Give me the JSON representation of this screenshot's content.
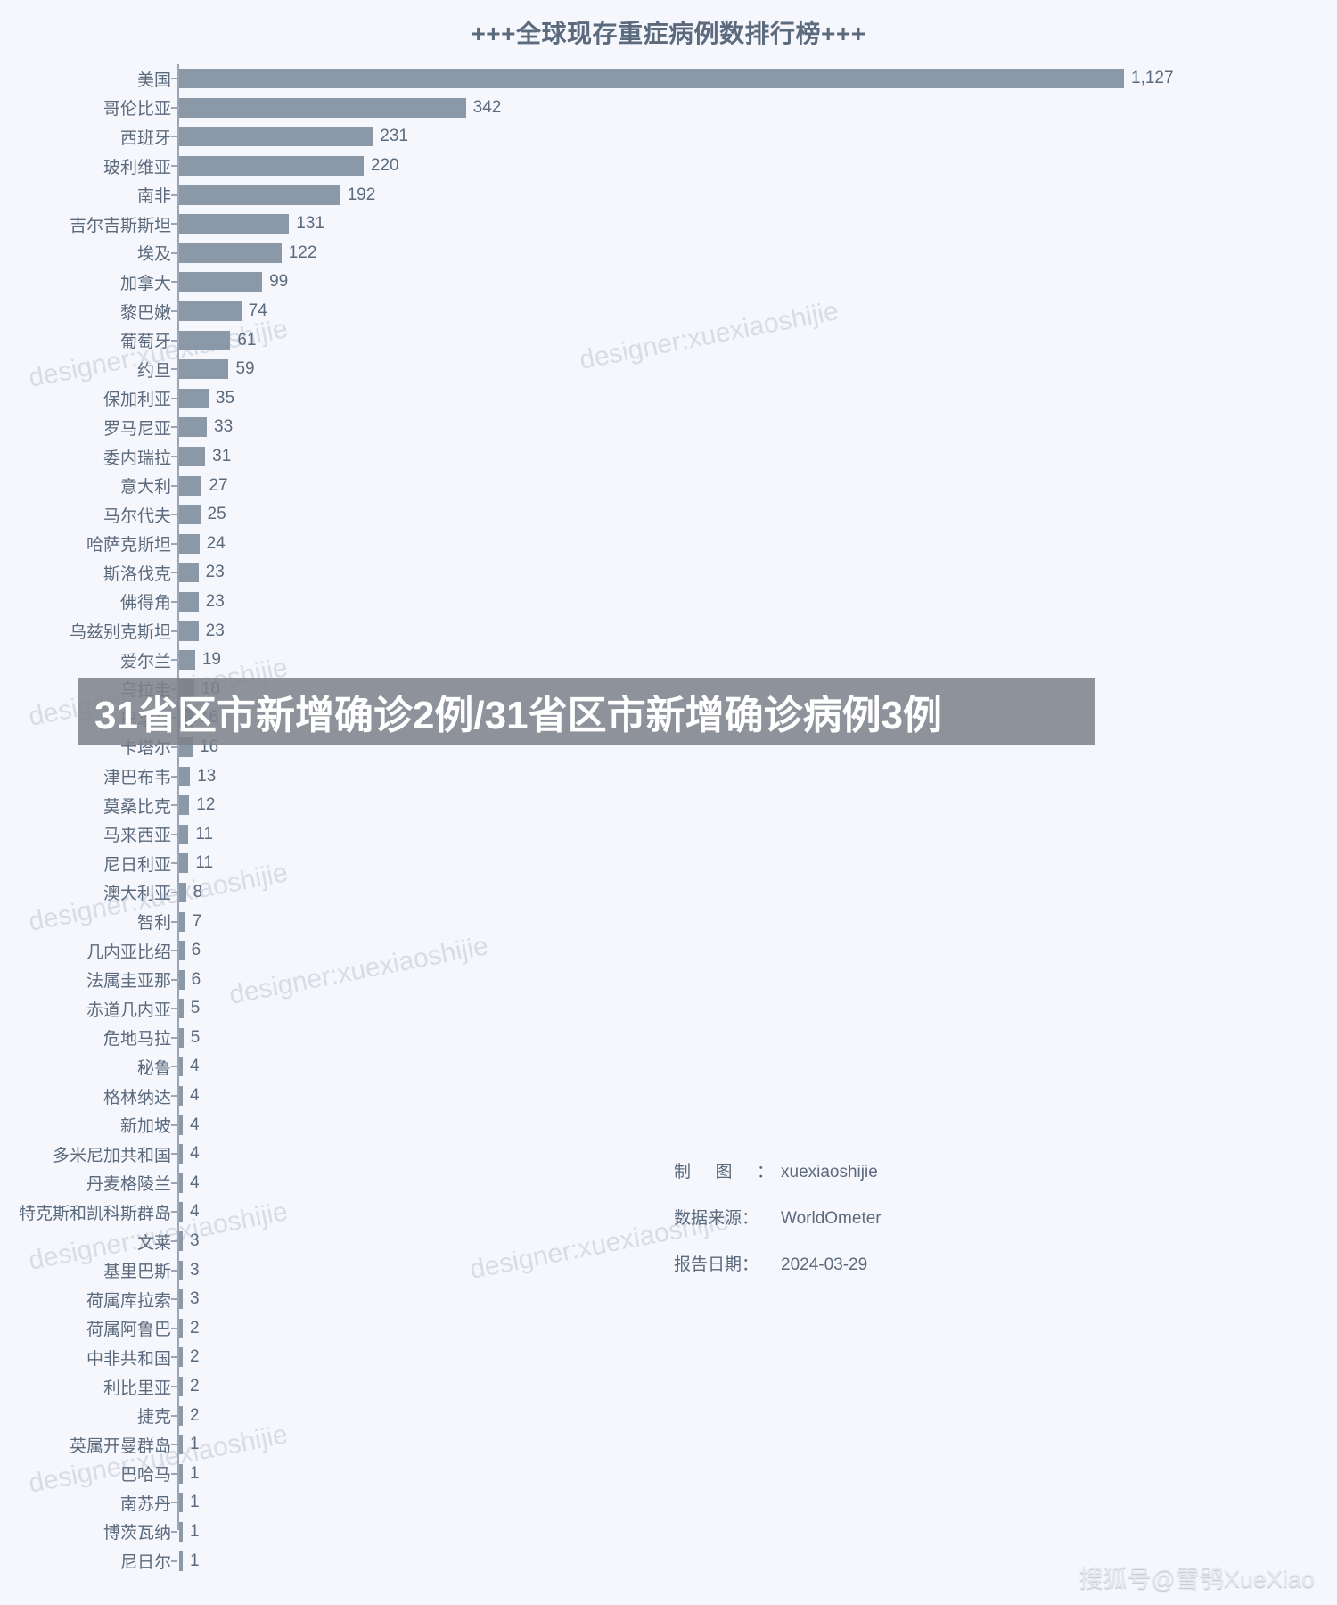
{
  "chart_data": {
    "type": "bar",
    "orientation": "horizontal",
    "title": "+++全球现存重症病例数排行榜+++",
    "xlabel": "",
    "ylabel": "",
    "grid": false,
    "legend": "none",
    "bar_color": "#8a98a8",
    "background_color": "#f5f7fc",
    "text_color": "#5b6a7d",
    "xlim": [
      0,
      1127
    ],
    "categories": [
      "美国",
      "哥伦比亚",
      "西班牙",
      "玻利维亚",
      "南非",
      "吉尔吉斯斯坦",
      "埃及",
      "加拿大",
      "黎巴嫩",
      "葡萄牙",
      "约旦",
      "保加利亚",
      "罗马尼亚",
      "委内瑞拉",
      "意大利",
      "马尔代夫",
      "哈萨克斯坦",
      "斯洛伐克",
      "佛得角",
      "乌兹别克斯坦",
      "爱尔兰",
      "乌拉圭",
      "巴拿马",
      "卡塔尔",
      "津巴布韦",
      "莫桑比克",
      "马来西亚",
      "尼日利亚",
      "澳大利亚",
      "智利",
      "几内亚比绍",
      "法属圭亚那",
      "赤道几内亚",
      "危地马拉",
      "秘鲁",
      "格林纳达",
      "新加坡",
      "多米尼加共和国",
      "丹麦格陵兰",
      "特克斯和凯科斯群岛",
      "文莱",
      "基里巴斯",
      "荷属库拉索",
      "荷属阿鲁巴",
      "中非共和国",
      "利比里亚",
      "捷克",
      "英属开曼群岛",
      "巴哈马",
      "南苏丹",
      "博茨瓦纳",
      "尼日尔"
    ],
    "values": [
      1127,
      342,
      231,
      220,
      192,
      131,
      122,
      99,
      74,
      61,
      59,
      35,
      33,
      31,
      27,
      25,
      24,
      23,
      23,
      23,
      19,
      18,
      16,
      16,
      13,
      12,
      11,
      11,
      8,
      7,
      6,
      6,
      5,
      5,
      4,
      4,
      4,
      4,
      4,
      4,
      3,
      3,
      3,
      2,
      2,
      2,
      2,
      1,
      1,
      1,
      1,
      1
    ],
    "value_labels": [
      "1,127",
      "342",
      "231",
      "220",
      "192",
      "131",
      "122",
      "99",
      "74",
      "61",
      "59",
      "35",
      "33",
      "31",
      "27",
      "25",
      "24",
      "23",
      "23",
      "23",
      "19",
      "18",
      "16",
      "16",
      "13",
      "12",
      "11",
      "11",
      "8",
      "7",
      "6",
      "6",
      "5",
      "5",
      "4",
      "4",
      "4",
      "4",
      "4",
      "4",
      "3",
      "3",
      "3",
      "2",
      "2",
      "2",
      "2",
      "1",
      "1",
      "1",
      "1",
      "1"
    ]
  },
  "footer": {
    "designer_key_a": "制",
    "designer_key_b": "图",
    "designer_colon": "：",
    "designer_value": "xuexiaoshijie",
    "source_key": "数据来源：",
    "source_value": "WorldOmeter",
    "date_key": "报告日期：",
    "date_value": "2024-03-29"
  },
  "overlay": {
    "banner_text": "31省区市新增确诊2例/31省区市新增确诊病例3例",
    "banner_color": "#7d828a"
  },
  "watermarks": {
    "designer": "designer:xuexiaoshijie",
    "sohu": "搜狐号@雪鸮XueXiao"
  }
}
